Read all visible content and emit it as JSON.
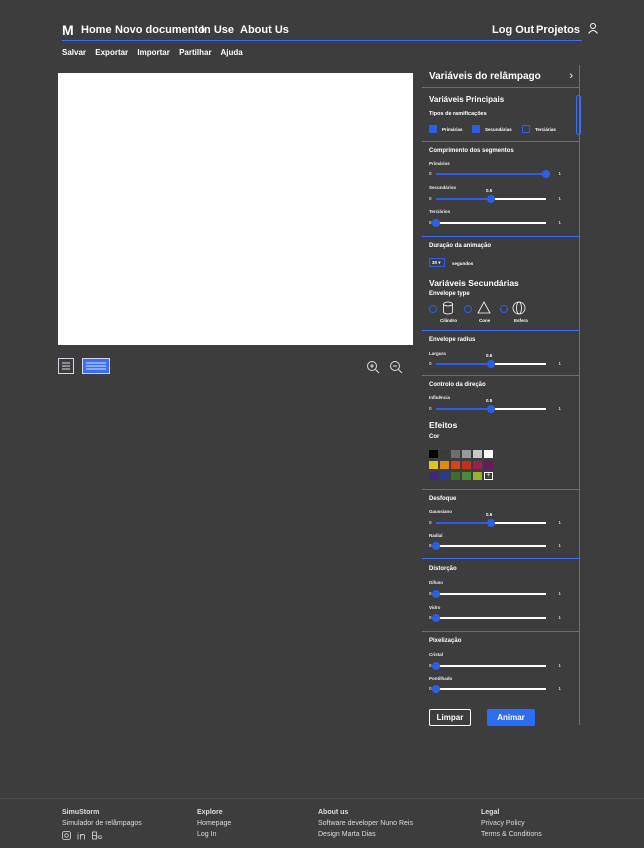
{
  "nav": {
    "logo": "M",
    "links": [
      "Home",
      "Novo documento",
      "In Use",
      "About Us"
    ],
    "logout": "Log Out",
    "projects": "Projetos"
  },
  "menu": [
    "Salvar",
    "Exportar",
    "Importar",
    "Partilhar",
    "Ajuda"
  ],
  "panel": {
    "title": "Variáveis do relâmpago",
    "main_title": "Variáveis Principais",
    "branch_types_label": "Tipos de ramificações",
    "branch_types": [
      {
        "label": "Primárias",
        "checked": true
      },
      {
        "label": "Secundárias",
        "checked": true
      },
      {
        "label": "Terciárias",
        "checked": false
      }
    ],
    "segments_title": "Comprimento dos segmentos",
    "segments": [
      {
        "label": "Primários",
        "min": "0",
        "max": "1",
        "value": 1,
        "value_label": ""
      },
      {
        "label": "Secundários",
        "min": "0",
        "max": "1",
        "value": 0.5,
        "value_label": "0.5"
      },
      {
        "label": "Terciários",
        "min": "0",
        "max": "1",
        "value": 0,
        "value_label": ""
      }
    ],
    "duration_title": "Duração da animação",
    "duration_value": "30",
    "duration_unit": "segundos",
    "secondary_title": "Variáveis Secundárias",
    "envelope_type_label": "Envelope type",
    "envelope_types": [
      "Cilindro",
      "Cone",
      "Esfera"
    ],
    "envelope_radius_title": "Envelope radius",
    "envelope_radius": {
      "label": "Largura",
      "min": "0",
      "max": "1",
      "value": 0.5,
      "value_label": "0.5"
    },
    "direction_title": "Controlo da direção",
    "direction": {
      "label": "Influência",
      "min": "0",
      "max": "1",
      "value": 0.5,
      "value_label": "0.5"
    },
    "effects_title": "Efeitos",
    "color_label": "Cor",
    "colors": [
      "#000000",
      "#3a3a3a",
      "#6e6e6e",
      "#9a9a9a",
      "#c8c8c8",
      "#ffffff",
      "#e0c515",
      "#e08a0f",
      "#d0481a",
      "#c0301f",
      "#a01f4e",
      "#6a1a58",
      "#3e2a7a",
      "#2a3d8c",
      "#3a6e2a",
      "#4a8c3a",
      "#9ab22a"
    ],
    "add_color": "+",
    "blur_title": "Desfoque",
    "blur": [
      {
        "label": "Gaussiano",
        "min": "0",
        "max": "1",
        "value": 0.5,
        "value_label": "0.5"
      },
      {
        "label": "Radial",
        "min": "0",
        "max": "1",
        "value": 0,
        "value_label": ""
      }
    ],
    "distortion_title": "Distorção",
    "distortion": [
      {
        "label": "Difuso",
        "min": "0",
        "max": "1",
        "value": 0,
        "value_label": ""
      },
      {
        "label": "Vidro",
        "min": "0",
        "max": "1",
        "value": 0,
        "value_label": ""
      }
    ],
    "pixel_title": "Pixelização",
    "pixel": [
      {
        "label": "Cristal",
        "min": "0",
        "max": "1",
        "value": 0,
        "value_label": ""
      },
      {
        "label": "Pontilhado",
        "min": "0",
        "max": "1",
        "value": 0,
        "value_label": ""
      }
    ],
    "clear_button": "Limpar",
    "animate_button": "Animar"
  },
  "footer": {
    "col1": {
      "title": "SimuStorm",
      "items": [
        "Simulador de relâmpagos"
      ]
    },
    "col2": {
      "title": "Explore",
      "items": [
        "Homepage",
        "Log In"
      ]
    },
    "col3": {
      "title": "About us",
      "items": [
        "Software developer Nuno Reis",
        "Design Marta Dias"
      ]
    },
    "col4": {
      "title": "Legal",
      "items": [
        "Privacy Policy",
        "Terms & Conditions"
      ]
    },
    "social_icons": [
      "instagram-icon",
      "linkedin-icon",
      "behance-icon"
    ]
  },
  "colors": {
    "accent": "#2d5fe6",
    "background": "#3d3d3d",
    "line": "#3b6ef0"
  }
}
